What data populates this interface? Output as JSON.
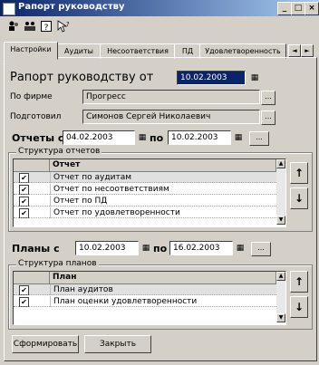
{
  "window": {
    "title": "Рапорт руководству",
    "buttons": [
      "_",
      "□",
      "×"
    ]
  },
  "toolbar": {
    "icons": [
      "users-icon",
      "users-group-icon",
      "help-icon",
      "whatsthis-icon"
    ]
  },
  "tabs": [
    "Настройки",
    "Аудиты",
    "Несоответствия",
    "ПД",
    "Удовлетворенность"
  ],
  "tab_arrows": [
    "◄",
    "►"
  ],
  "report": {
    "heading": "Рапорт руководству от",
    "date": "10.02.2003",
    "firm_label": "По фирме",
    "firm_value": "Прогресс",
    "prepared_label": "Подготовил",
    "prepared_value": "Симонов Сергей Николаевич",
    "dots": "..."
  },
  "reports_period": {
    "label_from": "Отчеты с",
    "date_from": "04.02.2003",
    "label_to": "по",
    "date_to": "10.02.2003",
    "dots": "..."
  },
  "reports_structure": {
    "title": "Структура отчетов",
    "column": "Отчет",
    "rows": [
      {
        "checked": "✔",
        "text": "Отчет по аудитам"
      },
      {
        "checked": "✔",
        "text": "Отчет по несоответствиям"
      },
      {
        "checked": "✔",
        "text": "Отчет по ПД"
      },
      {
        "checked": "✔",
        "text": "Отчет по удовлетворенности"
      }
    ]
  },
  "plans_period": {
    "label_from": "Планы с",
    "date_from": "10.02.2003",
    "label_to": "по",
    "date_to": "16.02.2003",
    "dots": "..."
  },
  "plans_structure": {
    "title": "Структура планов",
    "column": "План",
    "rows": [
      {
        "checked": "✔",
        "text": "План аудитов"
      },
      {
        "checked": "✔",
        "text": "План оценки удовлетворенности"
      }
    ]
  },
  "move": {
    "up": "↑",
    "down": "↓"
  },
  "scroll": {
    "up": "▲",
    "down": "▼"
  },
  "calendar_glyph": "▦",
  "buttons": {
    "generate": "Сформировать",
    "close": "Закрыть"
  }
}
